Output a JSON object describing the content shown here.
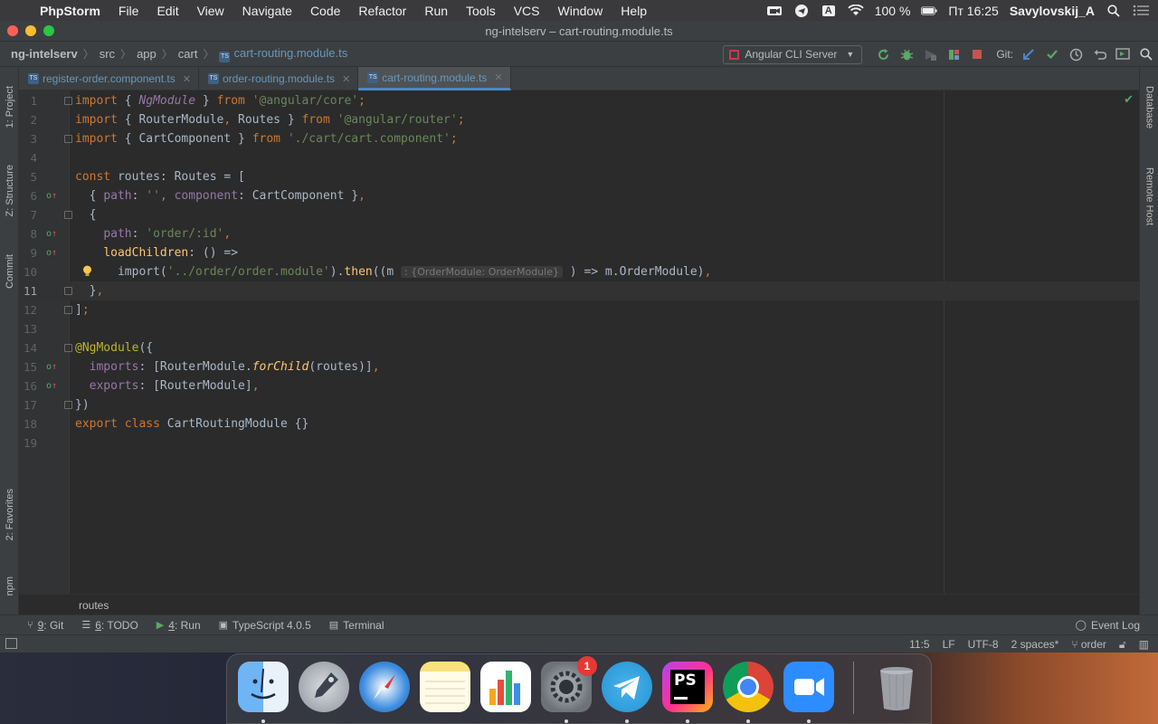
{
  "menubar": {
    "app_name": "PhpStorm",
    "items": [
      "File",
      "Edit",
      "View",
      "Navigate",
      "Code",
      "Refactor",
      "Run",
      "Tools",
      "VCS",
      "Window",
      "Help"
    ],
    "battery": "100 %",
    "clock": "Пт 16:25",
    "user": "Savylovskij_A",
    "input_source": "A"
  },
  "window": {
    "title": "ng-intelserv – cart-routing.module.ts"
  },
  "navbar": {
    "crumbs": [
      "ng-intelserv",
      "src",
      "app",
      "cart",
      "cart-routing.module.ts"
    ],
    "ts_badge": "TS",
    "run_config": "Angular CLI Server",
    "git_label": "Git:"
  },
  "tabs": [
    {
      "label": "register-order.component.ts",
      "active": false
    },
    {
      "label": "order-routing.module.ts",
      "active": false
    },
    {
      "label": "cart-routing.module.ts",
      "active": true
    }
  ],
  "left_toolwindows": [
    "1: Project",
    "Z: Structure",
    "Commit",
    "2: Favorites",
    "npm"
  ],
  "right_toolwindows": [
    "Database",
    "Remote Host"
  ],
  "editor": {
    "current_line": 11,
    "inlay_hint": ": {OrderModule: OrderModule}",
    "lines": [
      {
        "n": "1",
        "text": "import { NgModule } from '@angular/core';"
      },
      {
        "n": "2",
        "text": "import { RouterModule, Routes } from '@angular/router';"
      },
      {
        "n": "3",
        "text": "import { CartComponent } from './cart/cart.component';"
      },
      {
        "n": "4",
        "text": ""
      },
      {
        "n": "5",
        "text": "const routes: Routes = ["
      },
      {
        "n": "6",
        "text": "  { path: '', component: CartComponent },"
      },
      {
        "n": "7",
        "text": "  {"
      },
      {
        "n": "8",
        "text": "    path: 'order/:id',"
      },
      {
        "n": "9",
        "text": "    loadChildren: () =>"
      },
      {
        "n": "10",
        "text": "      import('../order/order.module').then((m ) => m.OrderModule),"
      },
      {
        "n": "11",
        "text": "  },"
      },
      {
        "n": "12",
        "text": "];"
      },
      {
        "n": "13",
        "text": ""
      },
      {
        "n": "14",
        "text": "@NgModule({"
      },
      {
        "n": "15",
        "text": "  imports: [RouterModule.forChild(routes)],"
      },
      {
        "n": "16",
        "text": "  exports: [RouterModule],"
      },
      {
        "n": "17",
        "text": "})"
      },
      {
        "n": "18",
        "text": "export class CartRoutingModule {}"
      },
      {
        "n": "19",
        "text": ""
      }
    ]
  },
  "editor_breadcrumb": "routes",
  "bottom_toolwindows": [
    {
      "key": "9",
      "label": ": Git"
    },
    {
      "key": "6",
      "label": ": TODO"
    },
    {
      "key": "4",
      "label": ": Run"
    },
    {
      "key": "",
      "label": "TypeScript 4.0.5"
    },
    {
      "key": "",
      "label": "Terminal"
    }
  ],
  "event_log": "Event Log",
  "statusbar": {
    "position": "11:5",
    "line_sep": "LF",
    "encoding": "UTF-8",
    "indent": "2 spaces*",
    "branch": "order"
  },
  "dock": {
    "apps": [
      "Finder",
      "Launchpad",
      "Safari",
      "Notes",
      "Numbers",
      "System Preferences",
      "Telegram",
      "PhpStorm",
      "Chrome",
      "Zoom",
      "Trash"
    ],
    "sys_prefs_badge": "1",
    "phpstorm_label": "PS"
  },
  "colors": {
    "keyword": "#cc7832",
    "string": "#6a8759",
    "annotation": "#bbb529",
    "property": "#9876aa",
    "function": "#ffc66d",
    "text": "#a9b7c6",
    "accent": "#4a88c7"
  }
}
